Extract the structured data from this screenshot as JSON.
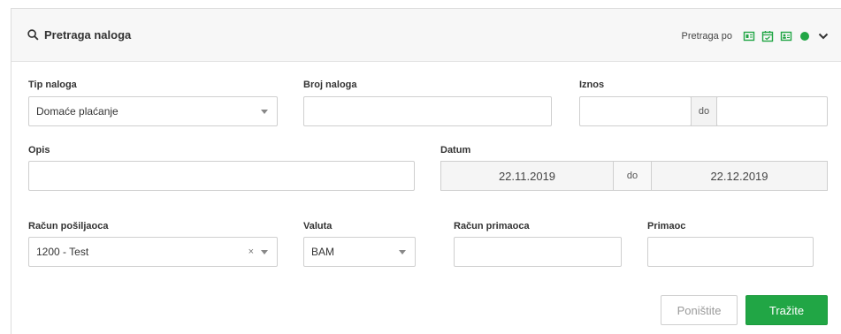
{
  "header": {
    "title": "Pretraga naloga",
    "search_by_label": "Pretraga po",
    "icons": [
      "card-icon",
      "calendar-icon",
      "id-card-icon",
      "green-dot-icon",
      "chevron-down-icon"
    ],
    "accent_color": "#21a645"
  },
  "form": {
    "tip_naloga": {
      "label": "Tip naloga",
      "value": "Domaće plaćanje"
    },
    "broj_naloga": {
      "label": "Broj naloga",
      "value": ""
    },
    "iznos": {
      "label": "Iznos",
      "from": "",
      "separator": "do",
      "to": ""
    },
    "opis": {
      "label": "Opis",
      "value": ""
    },
    "datum": {
      "label": "Datum",
      "from": "22.11.2019",
      "separator": "do",
      "to": "22.12.2019"
    },
    "racun_posiljaoca": {
      "label": "Račun pošiljaoca",
      "value": "1200 - Test",
      "clear": "×"
    },
    "valuta": {
      "label": "Valuta",
      "value": "BAM"
    },
    "racun_primaoca": {
      "label": "Račun primaoca",
      "value": ""
    },
    "primaoc": {
      "label": "Primaoc",
      "value": ""
    }
  },
  "actions": {
    "reset_label": "Poništite",
    "search_label": "Tražite"
  }
}
